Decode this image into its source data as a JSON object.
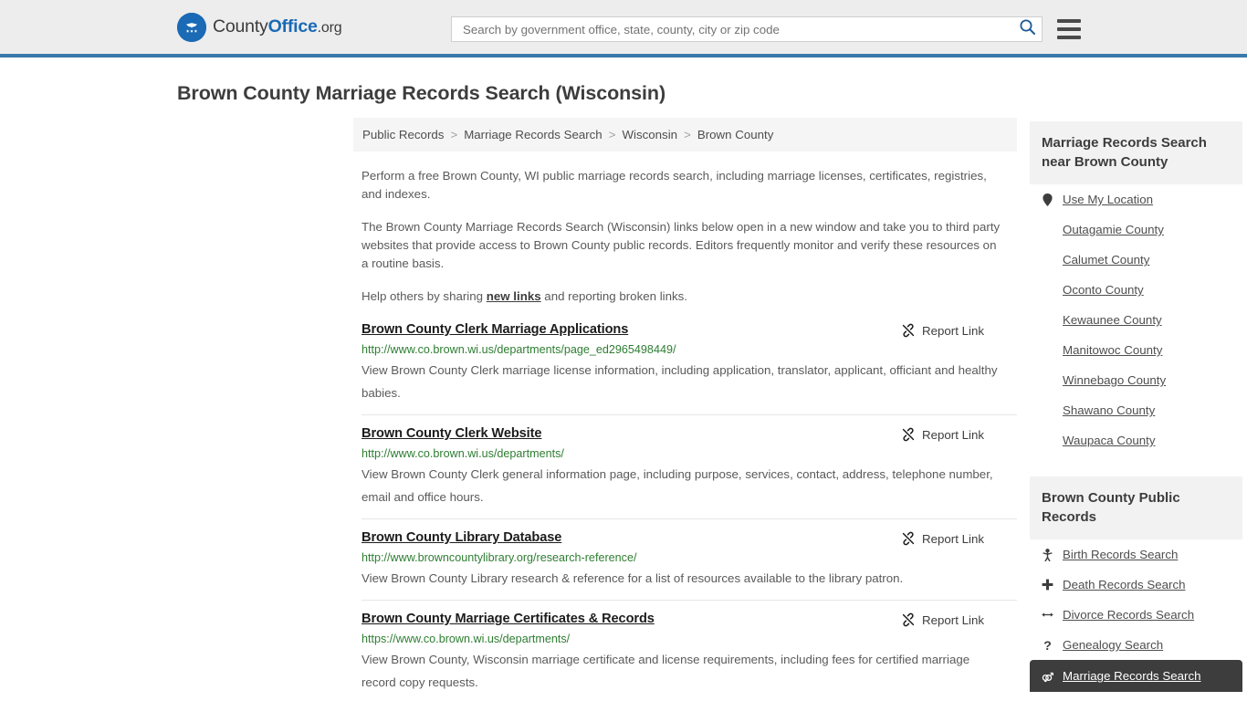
{
  "header": {
    "logo": {
      "text_county": "County",
      "text_office": "Office",
      "text_org": ".org",
      "icon": "eagle-seal-icon"
    },
    "search": {
      "placeholder": "Search by government office, state, county, city or zip code",
      "value": "",
      "icon": "search-icon"
    },
    "menu_icon": "hamburger-menu-icon"
  },
  "page_title": "Brown County Marriage Records Search (Wisconsin)",
  "breadcrumb": {
    "items": [
      {
        "label": "Public Records"
      },
      {
        "label": "Marriage Records Search"
      },
      {
        "label": "Wisconsin"
      },
      {
        "label": "Brown County"
      }
    ],
    "separator": ">"
  },
  "intro": {
    "paragraph_1": "Perform a free Brown County, WI public marriage records search, including marriage licenses, certificates, registries, and indexes.",
    "paragraph_2": "The Brown County Marriage Records Search (Wisconsin) links below open in a new window and take you to third party websites that provide access to Brown County public records. Editors frequently monitor and verify these resources on a routine basis.",
    "paragraph_3_before": "Help others by sharing ",
    "paragraph_3_link": "new links",
    "paragraph_3_after": " and reporting broken links."
  },
  "report_link_label": "Report Link",
  "report_link_icon": "broken-link-icon",
  "results": [
    {
      "title": "Brown County Clerk Marriage Applications",
      "url": "http://www.co.brown.wi.us/departments/page_ed2965498449/",
      "description": "View Brown County Clerk marriage license information, including application, translator, applicant, officiant and healthy babies."
    },
    {
      "title": "Brown County Clerk Website",
      "url": "http://www.co.brown.wi.us/departments/",
      "description": "View Brown County Clerk general information page, including purpose, services, contact, address, telephone number, email and office hours."
    },
    {
      "title": "Brown County Library Database",
      "url": "http://www.browncountylibrary.org/research-reference/",
      "description": "View Brown County Library research & reference for a list of resources available to the library patron."
    },
    {
      "title": "Brown County Marriage Certificates & Records",
      "url": "https://www.co.brown.wi.us/departments/",
      "description": "View Brown County, Wisconsin marriage certificate and license requirements, including fees for certified marriage record copy requests."
    }
  ],
  "sidebar": {
    "nearby": {
      "heading": "Marriage Records Search near Brown County",
      "items": [
        {
          "label": "Use My Location",
          "icon": "map-pin-icon"
        },
        {
          "label": "Outagamie County",
          "icon": ""
        },
        {
          "label": "Calumet County",
          "icon": ""
        },
        {
          "label": "Oconto County",
          "icon": ""
        },
        {
          "label": "Kewaunee County",
          "icon": ""
        },
        {
          "label": "Manitowoc County",
          "icon": ""
        },
        {
          "label": "Winnebago County",
          "icon": ""
        },
        {
          "label": "Shawano County",
          "icon": ""
        },
        {
          "label": "Waupaca County",
          "icon": ""
        }
      ]
    },
    "public_records": {
      "heading": "Brown County Public Records",
      "items": [
        {
          "label": "Birth Records Search",
          "icon": "baby-icon",
          "glyph": "👶",
          "active": false
        },
        {
          "label": "Death Records Search",
          "icon": "cross-icon",
          "glyph": "✚",
          "active": false
        },
        {
          "label": "Divorce Records Search",
          "icon": "left-right-arrow-icon",
          "glyph": "↔",
          "active": false
        },
        {
          "label": "Genealogy Search",
          "icon": "question-mark-icon",
          "glyph": "?",
          "active": false
        },
        {
          "label": "Marriage Records Search",
          "icon": "male-female-icon",
          "glyph": "⚥",
          "active": true
        }
      ]
    }
  },
  "colors": {
    "header_bg": "#ededed",
    "header_border": "#3b79aa",
    "brand_blue": "#1a6ab5",
    "url_green": "#2e7d32",
    "active_bg": "#3d3d3d",
    "panel_bg": "#f2f2f2",
    "breadcrumb_bg": "#f5f5f5"
  }
}
